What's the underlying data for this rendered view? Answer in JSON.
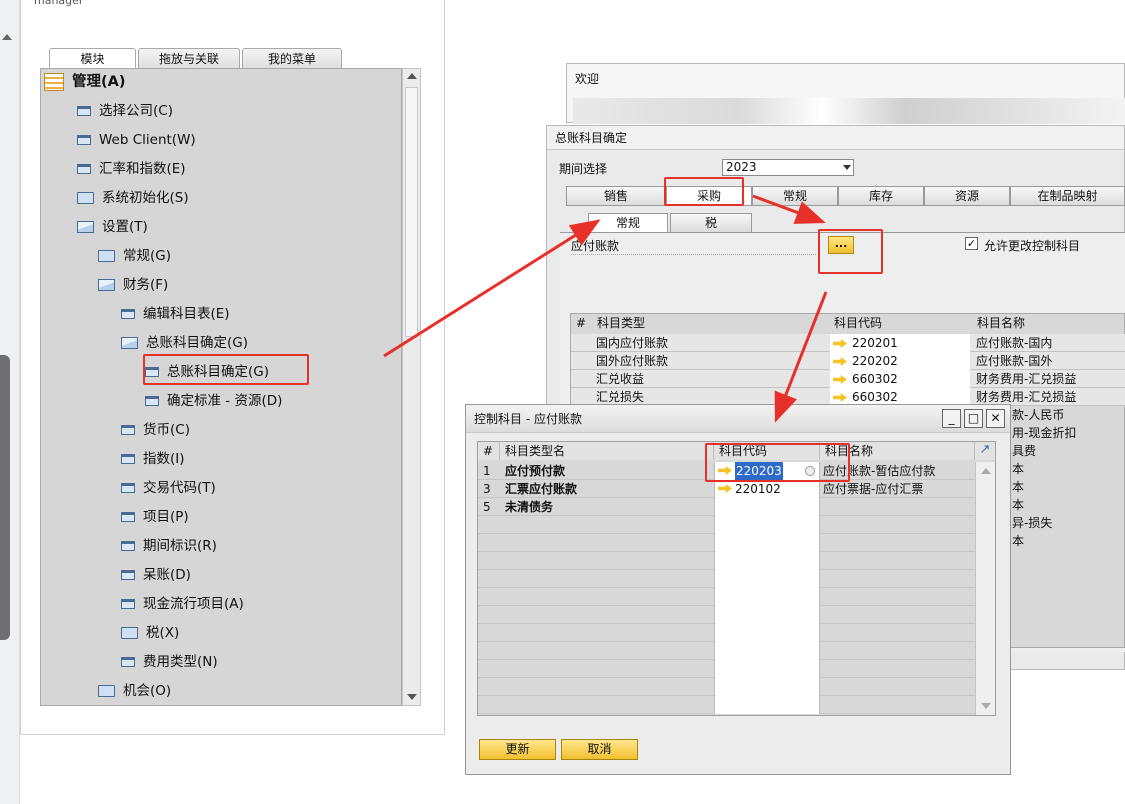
{
  "main_window": {
    "title_fragment": "manager",
    "tabs": [
      "模块",
      "拖放与关联",
      "我的菜单"
    ]
  },
  "tree": {
    "items": [
      {
        "label": "管理(A)",
        "icon": "grid-icon",
        "bold": true
      },
      {
        "label": "选择公司(C)",
        "icon": "doc-icon"
      },
      {
        "label": "Web Client(W)",
        "icon": "doc-icon"
      },
      {
        "label": "汇率和指数(E)",
        "icon": "doc-icon"
      },
      {
        "label": "系统初始化(S)",
        "icon": "folder-icon"
      },
      {
        "label": "设置(T)",
        "icon": "folder-open-icon"
      },
      {
        "label": "常规(G)",
        "icon": "folder-icon"
      },
      {
        "label": "财务(F)",
        "icon": "folder-open-icon"
      },
      {
        "label": "编辑科目表(E)",
        "icon": "doc-icon"
      },
      {
        "label": "总账科目确定(G)",
        "icon": "folder-open-icon"
      },
      {
        "label": "总账科目确定(G)",
        "icon": "doc-icon"
      },
      {
        "label": "确定标准 - 资源(D)",
        "icon": "doc-icon"
      },
      {
        "label": "货币(C)",
        "icon": "doc-icon"
      },
      {
        "label": "指数(I)",
        "icon": "doc-icon"
      },
      {
        "label": "交易代码(T)",
        "icon": "doc-icon"
      },
      {
        "label": "项目(P)",
        "icon": "doc-icon"
      },
      {
        "label": "期间标识(R)",
        "icon": "doc-icon"
      },
      {
        "label": "呆账(D)",
        "icon": "doc-icon"
      },
      {
        "label": "现金流行项目(A)",
        "icon": "doc-icon"
      },
      {
        "label": "税(X)",
        "icon": "folder-icon"
      },
      {
        "label": "费用类型(N)",
        "icon": "doc-icon"
      },
      {
        "label": "机会(O)",
        "icon": "folder-icon"
      }
    ]
  },
  "welcome": {
    "title": "欢迎"
  },
  "gl_window": {
    "title": "总账科目确定",
    "period_label": "期间选择",
    "period_value": "2023",
    "tabs": [
      "销售",
      "采购",
      "常规",
      "库存",
      "资源",
      "在制品映射"
    ],
    "subtabs": [
      "常规",
      "税"
    ],
    "field_label": "应付账款",
    "dots_label": "...",
    "allow_change_label": "允许更改控制科目",
    "allow_change_checked": "✓",
    "grid_headers": [
      "#",
      "科目类型",
      "科目代码",
      "科目名称"
    ],
    "rows": [
      {
        "type": "国内应付账款",
        "code": "220201",
        "name": "应付账款-国内"
      },
      {
        "type": "国外应付账款",
        "code": "220202",
        "name": "应付账款-国外"
      },
      {
        "type": "汇兑收益",
        "code": "660302",
        "name": "财务费用-汇兑损益"
      },
      {
        "type": "汇兑损失",
        "code": "660302",
        "name": "财务费用-汇兑损益"
      }
    ],
    "right_names": [
      "款-人民币",
      "用-现金折扣",
      "具费",
      "本",
      "本",
      "本",
      "异-损失",
      "本"
    ]
  },
  "ctrl_window": {
    "title": "控制科目 - 应付账款",
    "headers": [
      "#",
      "科目类型名",
      "科目代码",
      "科目名称"
    ],
    "rows": [
      {
        "num": "1",
        "name": "应付预付款",
        "code": "220203",
        "acct": "应付账款-暂估应付款"
      },
      {
        "num": "3",
        "name": "汇票应付账款",
        "code": "220102",
        "acct": "应付票据-应付汇票"
      },
      {
        "num": "5",
        "name": "未清债务",
        "code": "",
        "acct": ""
      }
    ],
    "update_label": "更新",
    "cancel_label": "取消"
  }
}
